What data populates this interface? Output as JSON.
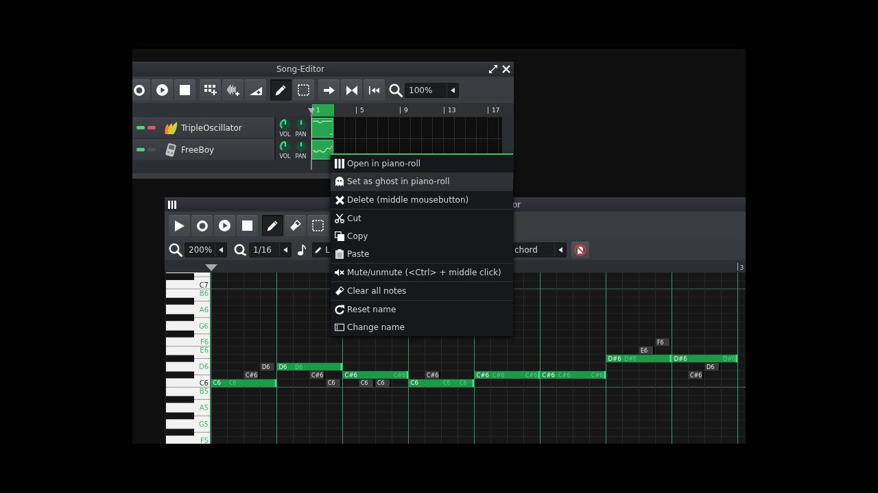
{
  "song_editor": {
    "title": "Song-Editor",
    "toolbar": [
      {
        "buttons": [
          {
            "kind": "record",
            "selected": false
          },
          {
            "kind": "play",
            "selected": false
          },
          {
            "kind": "stop",
            "selected": false
          }
        ]
      },
      {
        "buttons": [
          {
            "kind": "add_pattern",
            "selected": false
          },
          {
            "kind": "add_sample",
            "selected": false
          },
          {
            "kind": "add_automation",
            "selected": false
          }
        ]
      },
      {
        "buttons": [
          {
            "kind": "draw",
            "selected": true
          },
          {
            "kind": "select",
            "selected": false
          }
        ]
      },
      {
        "buttons": [
          {
            "kind": "follow",
            "selected": false
          },
          {
            "kind": "loop",
            "selected": false
          },
          {
            "kind": "rewind",
            "selected": false
          }
        ]
      }
    ],
    "zoom": {
      "value": "100%"
    },
    "timeline": {
      "markers": [
        "1",
        "5",
        "9",
        "13",
        "17"
      ]
    },
    "tracks": [
      {
        "name": "TripleOscillator",
        "kind": "oscillator",
        "active": true,
        "solo": true,
        "knobs": [
          {
            "label": "VOL",
            "kind": "unipolar",
            "level": 0.5
          },
          {
            "label": "PAN",
            "kind": "bipolar",
            "level": 0.5
          }
        ]
      },
      {
        "name": "FreeBoy",
        "kind": "handheld",
        "active": true,
        "solo": false,
        "knobs": [
          {
            "label": "VOL",
            "kind": "unipolar",
            "level": 0.5
          },
          {
            "label": "PAN",
            "kind": "bipolar",
            "level": 0.5
          }
        ]
      }
    ]
  },
  "context_menu": {
    "sections": [
      {
        "items": [
          {
            "kind": "piano",
            "label": "Open in piano-roll",
            "selected": false
          },
          {
            "kind": "ghost",
            "label": "Set as ghost in piano-roll",
            "selected": true
          }
        ]
      },
      {
        "items": [
          {
            "kind": "delete",
            "label": "Delete (middle mousebutton)",
            "selected": false
          }
        ]
      },
      {
        "items": [
          {
            "kind": "cut",
            "label": "Cut",
            "selected": false
          },
          {
            "kind": "copy",
            "label": "Copy",
            "selected": false
          },
          {
            "kind": "paste",
            "label": "Paste",
            "selected": false
          }
        ]
      },
      {
        "items": [
          {
            "kind": "mute",
            "label": "Mute/unmute (<Ctrl> + middle click)",
            "selected": false
          }
        ]
      },
      {
        "items": [
          {
            "kind": "clear",
            "label": "Clear all notes",
            "selected": false
          }
        ]
      },
      {
        "items": [
          {
            "kind": "reset",
            "label": "Reset name",
            "selected": false
          },
          {
            "kind": "rename",
            "label": "Change name",
            "selected": false
          }
        ]
      }
    ]
  },
  "piano_roll": {
    "title": "or",
    "toolbar": [
      {
        "buttons": [
          {
            "kind": "play",
            "selected": false
          },
          {
            "kind": "record",
            "selected": false
          },
          {
            "kind": "recordplay",
            "selected": false
          },
          {
            "kind": "stop",
            "selected": false
          }
        ]
      },
      {
        "buttons": [
          {
            "kind": "draw",
            "selected": true
          },
          {
            "kind": "erase",
            "selected": false
          },
          {
            "kind": "select",
            "selected": false
          }
        ]
      }
    ],
    "zoom": {
      "value": "200%"
    },
    "quantize": {
      "value": "1/16"
    },
    "note_length": {
      "value": "L"
    },
    "chord": {
      "value": "chord"
    },
    "keys": [
      {
        "kind": "black"
      },
      {
        "kind": "white",
        "label": "C7",
        "highlighted": false
      },
      {
        "kind": "white",
        "label": "B6",
        "highlighted": true
      },
      {
        "kind": "black"
      },
      {
        "kind": "white",
        "label": "A6",
        "highlighted": true
      },
      {
        "kind": "black"
      },
      {
        "kind": "white",
        "label": "G6",
        "highlighted": true
      },
      {
        "kind": "black"
      },
      {
        "kind": "white",
        "label": "F6",
        "highlighted": true
      },
      {
        "kind": "white",
        "label": "E6",
        "highlighted": true
      },
      {
        "kind": "black"
      },
      {
        "kind": "white",
        "label": "D6",
        "highlighted": true
      },
      {
        "kind": "black"
      },
      {
        "kind": "white",
        "label": "C6",
        "highlighted": false
      },
      {
        "kind": "white",
        "label": "B5",
        "highlighted": true
      },
      {
        "kind": "black"
      },
      {
        "kind": "white",
        "label": "A5",
        "highlighted": true
      },
      {
        "kind": "black"
      },
      {
        "kind": "white",
        "label": "G5",
        "highlighted": true
      },
      {
        "kind": "black"
      },
      {
        "kind": "white",
        "label": "F5",
        "highlighted": true
      }
    ],
    "timeline": {
      "markers": [
        "3"
      ]
    },
    "notes": [
      {
        "label": "C6",
        "kind": "note"
      },
      {
        "label": "C6",
        "kind": "ghost"
      },
      {
        "label": "C#6",
        "kind": "ghost"
      },
      {
        "label": "D6",
        "kind": "ghost"
      },
      {
        "label": "D6",
        "kind": "note"
      },
      {
        "label": "D6",
        "kind": "ghost"
      },
      {
        "label": "C#6",
        "kind": "ghost"
      },
      {
        "label": "C6",
        "kind": "ghost"
      },
      {
        "label": "C#6",
        "kind": "note"
      },
      {
        "label": "C6",
        "kind": "ghost"
      },
      {
        "label": "C6",
        "kind": "ghost"
      },
      {
        "label": "C#6",
        "kind": "ghost"
      },
      {
        "label": "C6",
        "kind": "note"
      },
      {
        "label": "C#6",
        "kind": "ghost"
      },
      {
        "label": "C6",
        "kind": "ghost"
      },
      {
        "label": "C6",
        "kind": "ghost"
      },
      {
        "label": "C#6",
        "kind": "note"
      },
      {
        "label": "C#6",
        "kind": "ghost"
      },
      {
        "label": "C#6",
        "kind": "ghost"
      },
      {
        "label": "C#6",
        "kind": "note"
      },
      {
        "label": "C#6",
        "kind": "ghost"
      },
      {
        "label": "C#6",
        "kind": "ghost"
      },
      {
        "label": "D#6",
        "kind": "note"
      },
      {
        "label": "D#6",
        "kind": "ghost"
      },
      {
        "label": "E6",
        "kind": "ghost"
      },
      {
        "label": "F6",
        "kind": "ghost"
      },
      {
        "label": "D#6",
        "kind": "note"
      },
      {
        "label": "C#6",
        "kind": "ghost"
      },
      {
        "label": "D6",
        "kind": "ghost"
      },
      {
        "label": "D#6",
        "kind": "ghost"
      }
    ]
  }
}
